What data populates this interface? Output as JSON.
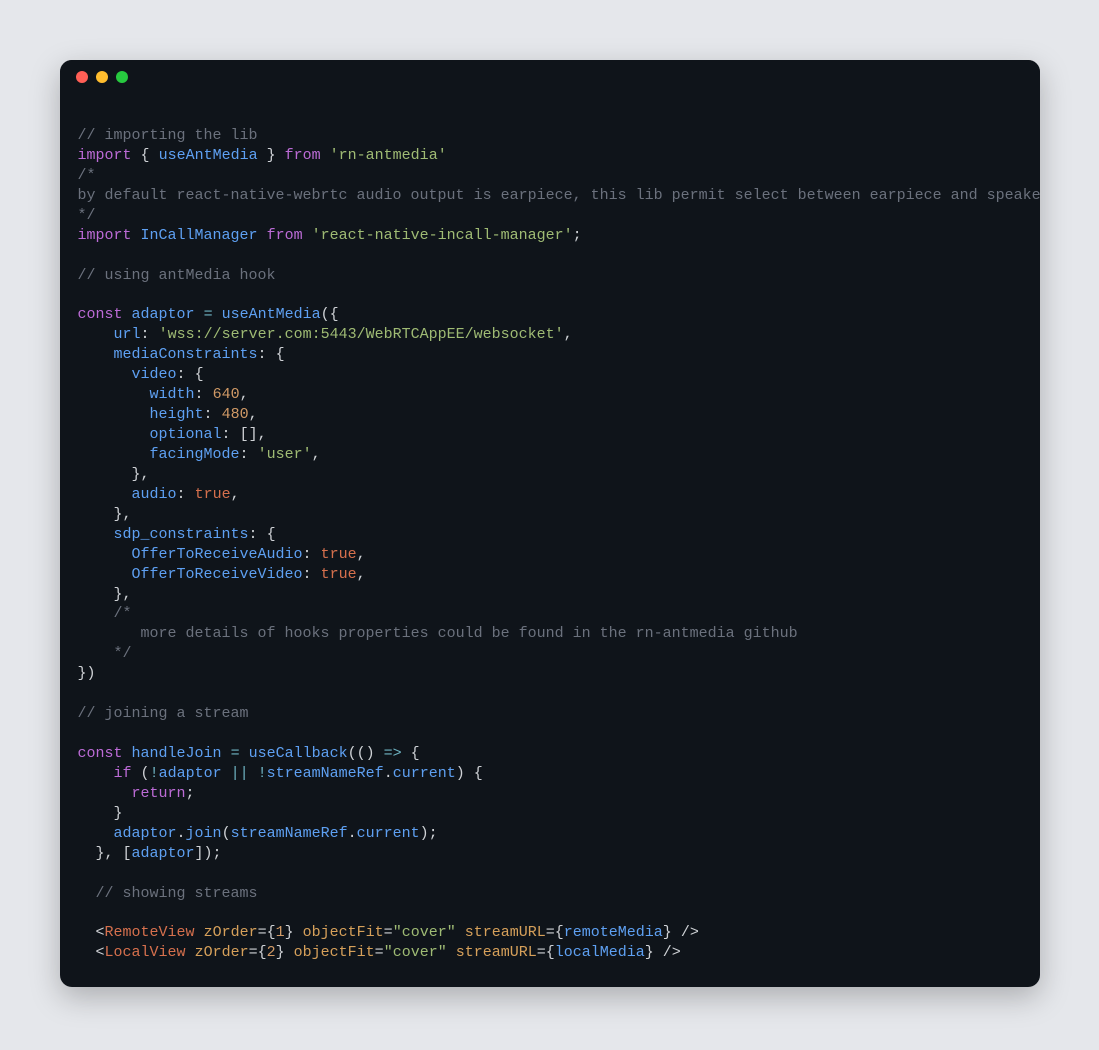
{
  "window": {
    "dots": [
      "red",
      "yellow",
      "green"
    ]
  },
  "code": {
    "c1": "// importing the lib",
    "l2": {
      "kw1": "import",
      "br1": "{",
      "id": "useAntMedia",
      "br2": "}",
      "kw2": "from",
      "str": "'rn-antmedia'"
    },
    "c2a": "/*",
    "c2b": "by default react-native-webrtc audio output is earpiece, this lib permit select between earpiece and speaker",
    "c2c": "*/",
    "l3": {
      "kw1": "import",
      "id": "InCallManager",
      "kw2": "from",
      "str": "'react-native-incall-manager'",
      "semi": ";"
    },
    "c3": "// using antMedia hook",
    "l4": {
      "kw": "const",
      "id1": "adaptor",
      "eq": "=",
      "id2": "useAntMedia",
      "open": "({"
    },
    "l5": {
      "key": "url",
      "str": "'wss://server.com:5443/WebRTCAppEE/websocket'"
    },
    "l6": {
      "key": "mediaConstraints",
      "open": "{"
    },
    "l7": {
      "key": "video",
      "open": "{"
    },
    "l8": {
      "key": "width",
      "num": "640"
    },
    "l9": {
      "key": "height",
      "num": "480"
    },
    "l10": {
      "key": "optional",
      "val": "[]"
    },
    "l11": {
      "key": "facingMode",
      "str": "'user'"
    },
    "l12": "},",
    "l13": {
      "key": "audio",
      "bool": "true"
    },
    "l14": "},",
    "l15": {
      "key": "sdp_constraints",
      "open": "{"
    },
    "l16": {
      "key": "OfferToReceiveAudio",
      "bool": "true"
    },
    "l17": {
      "key": "OfferToReceiveVideo",
      "bool": "true"
    },
    "l18": "},",
    "c4a": "/*",
    "c4b": "   more details of hooks properties could be found in the rn-antmedia github",
    "c4c": "*/",
    "l19": "})",
    "c5": "// joining a stream",
    "l20": {
      "kw": "const",
      "id1": "handleJoin",
      "eq": "=",
      "id2": "useCallback",
      "arrow": "(() => {"
    },
    "l21": {
      "kw": "if",
      "not1": "!",
      "id1": "adaptor",
      "or": "||",
      "not2": "!",
      "id2": "streamNameRef",
      "dot": ".",
      "id3": "current",
      "close": ") {"
    },
    "l22": {
      "kw": "return",
      "semi": ";"
    },
    "l23": "}",
    "l24": {
      "id1": "adaptor",
      "dot1": ".",
      "fn": "join",
      "open": "(",
      "id2": "streamNameRef",
      "dot2": ".",
      "id3": "current",
      "close": ");"
    },
    "l25": {
      "close1": "}, [",
      "id": "adaptor",
      "close2": "]);"
    },
    "c6": "// showing streams",
    "jsx1": {
      "open": "<",
      "tag": "RemoteView",
      "sp": " ",
      "a1": "zOrder",
      "eq1": "=",
      "b1o": "{",
      "n1": "1",
      "b1c": "}",
      "a2": "objectFit",
      "eq2": "=",
      "s2": "\"cover\"",
      "a3": "streamURL",
      "eq3": "=",
      "b3o": "{",
      "id3": "remoteMedia",
      "b3c": "}",
      "close": " />"
    },
    "jsx2": {
      "open": "<",
      "tag": "LocalView",
      "sp": " ",
      "a1": "zOrder",
      "eq1": "=",
      "b1o": "{",
      "n1": "2",
      "b1c": "}",
      "a2": "objectFit",
      "eq2": "=",
      "s2": "\"cover\"",
      "a3": "streamURL",
      "eq3": "=",
      "b3o": "{",
      "id3": "localMedia",
      "b3c": "}",
      "close": " />"
    }
  }
}
